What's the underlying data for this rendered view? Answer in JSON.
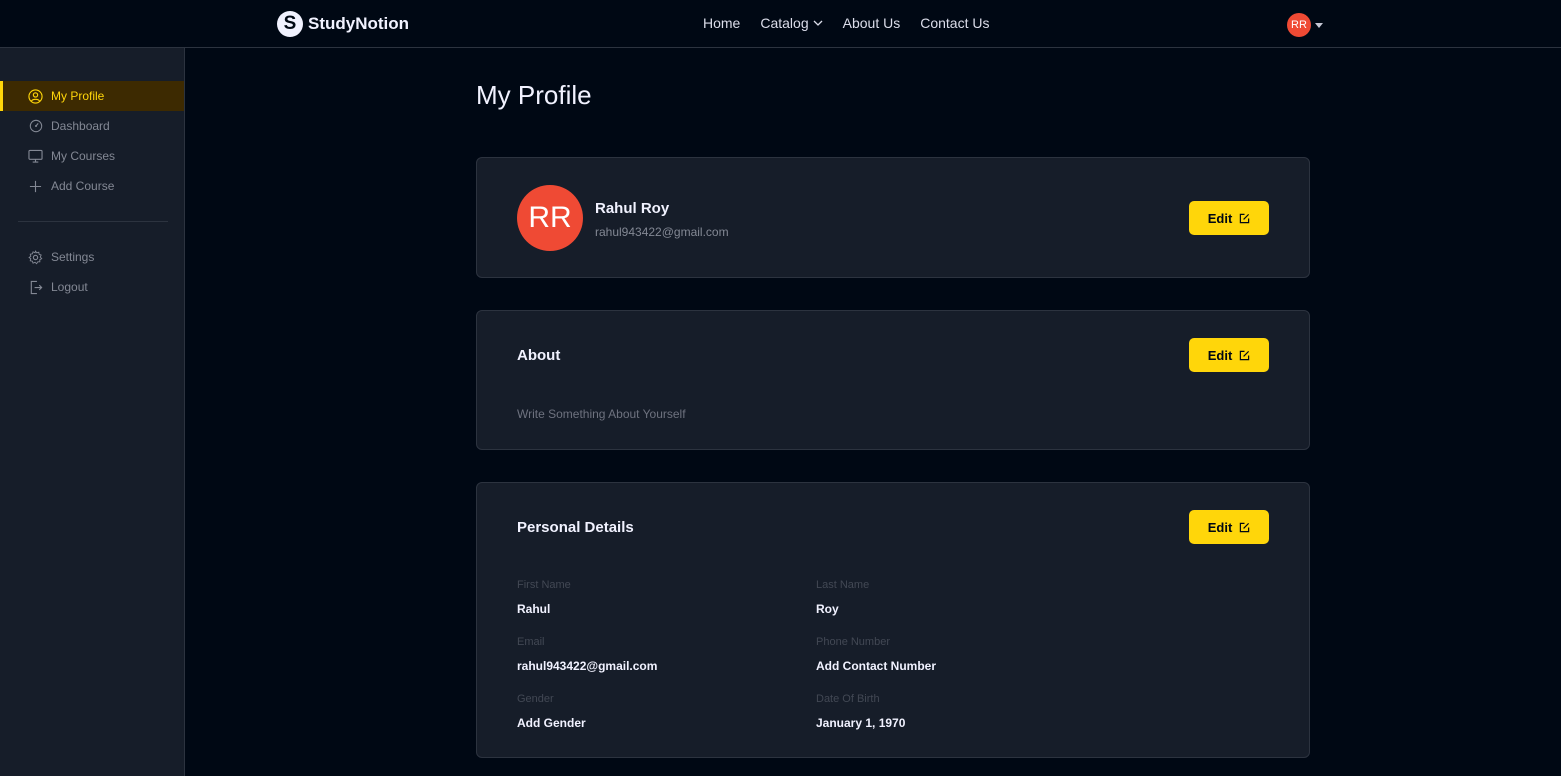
{
  "header": {
    "brand": "StudyNotion",
    "brand_letter": "S",
    "nav": [
      "Home",
      "Catalog",
      "About Us",
      "Contact Us"
    ],
    "user_initials": "RR"
  },
  "sidebar": {
    "items": [
      {
        "label": "My Profile",
        "icon": "user-circle-icon",
        "active": true
      },
      {
        "label": "Dashboard",
        "icon": "dashboard-icon"
      },
      {
        "label": "My Courses",
        "icon": "monitor-icon"
      },
      {
        "label": "Add Course",
        "icon": "plus-icon"
      }
    ],
    "bottom": [
      {
        "label": "Settings",
        "icon": "gear-icon"
      },
      {
        "label": "Logout",
        "icon": "logout-icon"
      }
    ]
  },
  "page": {
    "title": "My Profile"
  },
  "profile": {
    "initials": "RR",
    "name": "Rahul Roy",
    "email": "rahul943422@gmail.com",
    "edit": "Edit"
  },
  "about": {
    "title": "About",
    "text": "Write Something About Yourself",
    "edit": "Edit"
  },
  "personal": {
    "title": "Personal Details",
    "edit": "Edit",
    "fields": [
      {
        "label": "First Name",
        "value": "Rahul"
      },
      {
        "label": "Last Name",
        "value": "Roy"
      },
      {
        "label": "Email",
        "value": "rahul943422@gmail.com"
      },
      {
        "label": "Phone Number",
        "value": "Add Contact Number"
      },
      {
        "label": "Gender",
        "value": "Add Gender"
      },
      {
        "label": "Date Of Birth",
        "value": "January 1, 1970"
      }
    ]
  },
  "colors": {
    "accent": "#FFD60A",
    "avatar": "#EF4A34",
    "bg": "#000814",
    "card": "#161D29"
  }
}
